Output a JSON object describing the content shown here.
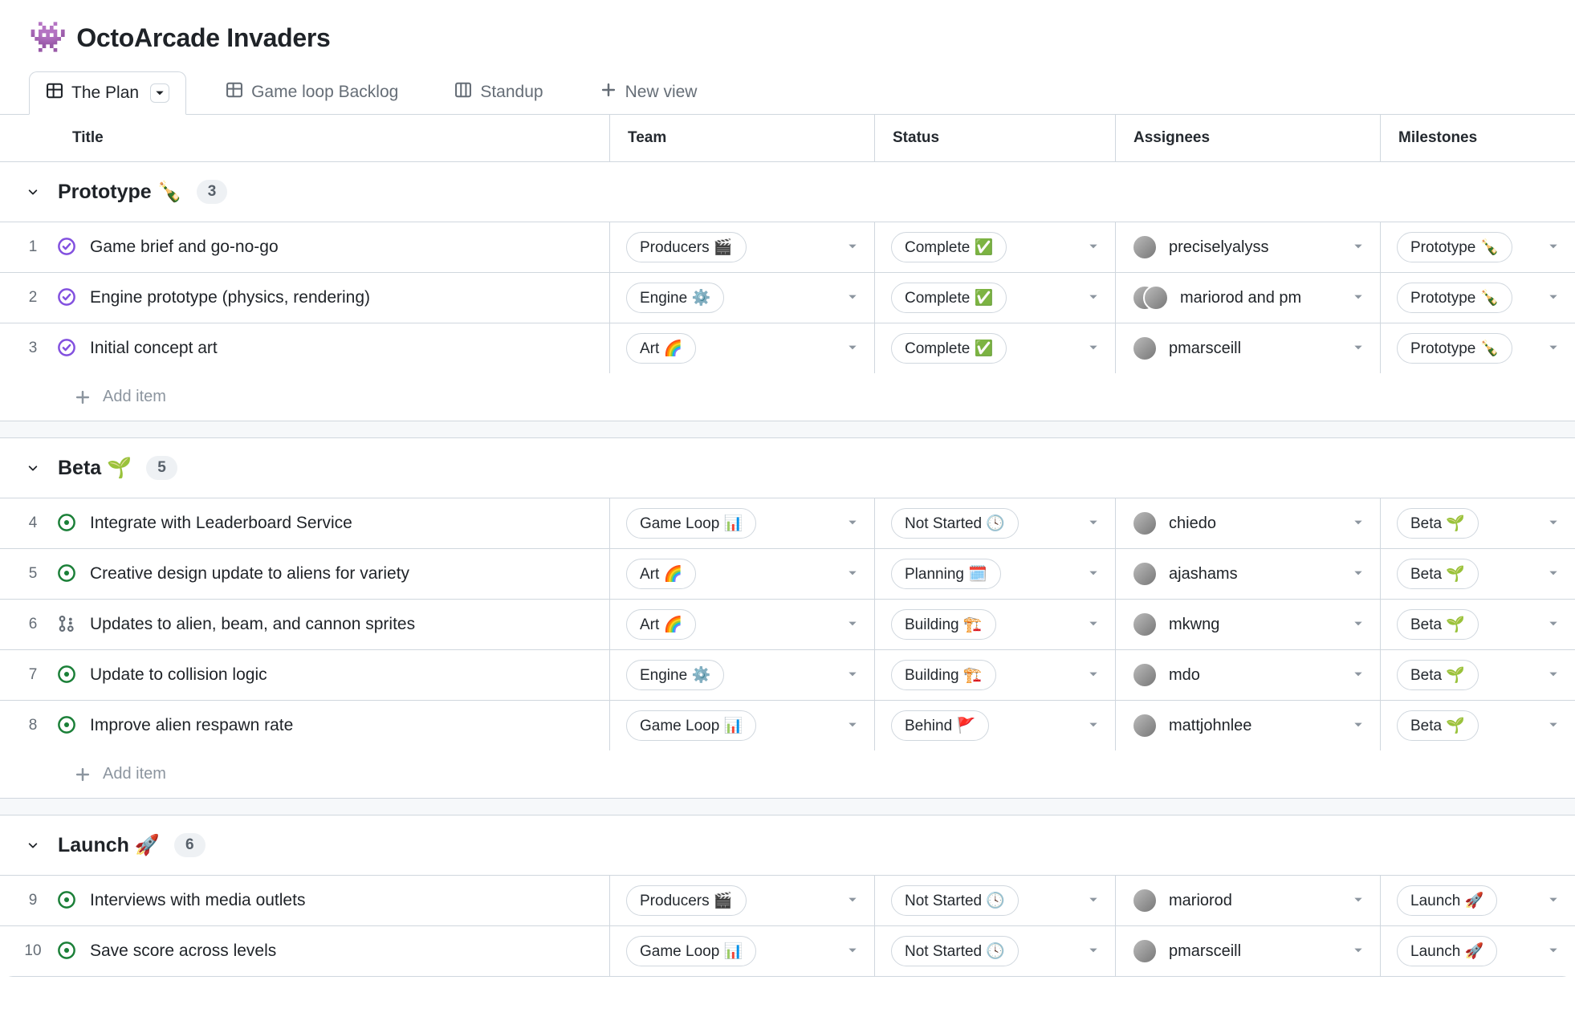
{
  "project": {
    "icon": "👾",
    "title": "OctoArcade Invaders"
  },
  "tabs": [
    {
      "label": "The Plan",
      "kind": "table",
      "active": true,
      "has_menu": true
    },
    {
      "label": "Game loop Backlog",
      "kind": "table",
      "active": false
    },
    {
      "label": "Standup",
      "kind": "board",
      "active": false
    },
    {
      "label": "New view",
      "kind": "new",
      "active": false
    }
  ],
  "columns": [
    "Title",
    "Team",
    "Status",
    "Assignees",
    "Milestones"
  ],
  "add_item_label": "Add item",
  "groups": [
    {
      "title": "Prototype 🍾",
      "count": "3",
      "rows": [
        {
          "num": "1",
          "icon": "issue-closed-purple",
          "title": "Game brief and go-no-go",
          "team": "Producers 🎬",
          "status": "Complete ✅",
          "assignees": {
            "avatars": 1,
            "text": "preciselyalyss"
          },
          "milestone": "Prototype 🍾"
        },
        {
          "num": "2",
          "icon": "issue-closed-purple",
          "title": "Engine prototype (physics, rendering)",
          "team": "Engine ⚙️",
          "status": "Complete ✅",
          "assignees": {
            "avatars": 2,
            "text": "mariorod and pm"
          },
          "milestone": "Prototype 🍾"
        },
        {
          "num": "3",
          "icon": "issue-closed-purple",
          "title": "Initial concept art",
          "team": "Art 🌈",
          "status": "Complete ✅",
          "assignees": {
            "avatars": 1,
            "text": "pmarsceill"
          },
          "milestone": "Prototype 🍾"
        }
      ]
    },
    {
      "title": "Beta 🌱",
      "count": "5",
      "rows": [
        {
          "num": "4",
          "icon": "issue-open-green",
          "title": "Integrate with Leaderboard Service",
          "team": "Game Loop 📊",
          "status": "Not Started 🕓",
          "assignees": {
            "avatars": 1,
            "text": "chiedo"
          },
          "milestone": "Beta 🌱"
        },
        {
          "num": "5",
          "icon": "issue-open-green",
          "title": "Creative design update to aliens for variety",
          "team": "Art 🌈",
          "status": "Planning 🗓️",
          "assignees": {
            "avatars": 1,
            "text": "ajashams"
          },
          "milestone": "Beta 🌱"
        },
        {
          "num": "6",
          "icon": "pr-draft",
          "title": "Updates to alien, beam, and cannon sprites",
          "team": "Art 🌈",
          "status": "Building 🏗️",
          "assignees": {
            "avatars": 1,
            "text": "mkwng"
          },
          "milestone": "Beta 🌱"
        },
        {
          "num": "7",
          "icon": "issue-open-green",
          "title": "Update to collision logic",
          "team": "Engine ⚙️",
          "status": "Building 🏗️",
          "assignees": {
            "avatars": 1,
            "text": "mdo"
          },
          "milestone": "Beta 🌱"
        },
        {
          "num": "8",
          "icon": "issue-open-green",
          "title": "Improve alien respawn rate",
          "team": "Game Loop 📊",
          "status": "Behind 🚩",
          "assignees": {
            "avatars": 1,
            "text": "mattjohnlee"
          },
          "milestone": "Beta 🌱"
        }
      ]
    },
    {
      "title": "Launch 🚀",
      "count": "6",
      "rows": [
        {
          "num": "9",
          "icon": "issue-open-green",
          "title": "Interviews with media outlets",
          "team": "Producers 🎬",
          "status": "Not Started 🕓",
          "assignees": {
            "avatars": 1,
            "text": "mariorod"
          },
          "milestone": "Launch 🚀"
        },
        {
          "num": "10",
          "icon": "issue-open-green",
          "title": "Save score across levels",
          "team": "Game Loop 📊",
          "status": "Not Started 🕓",
          "assignees": {
            "avatars": 1,
            "text": "pmarsceill"
          },
          "milestone": "Launch 🚀"
        }
      ]
    }
  ]
}
